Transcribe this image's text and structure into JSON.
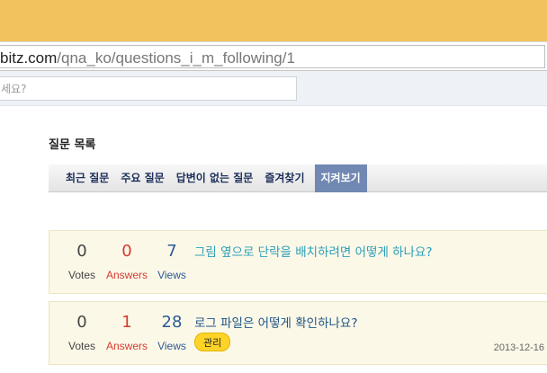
{
  "browser": {
    "url_host": "bitz.com",
    "url_path": "/qna_ko/questions_i_m_following/1"
  },
  "search": {
    "placeholder": "세요?"
  },
  "page": {
    "title": "질문 목록"
  },
  "tabs": [
    {
      "label": "최근 질문"
    },
    {
      "label": "주요 질문"
    },
    {
      "label": "답변이 없는 질문"
    },
    {
      "label": "즐겨찾기"
    },
    {
      "label": "지켜보기",
      "active": true
    }
  ],
  "questions": [
    {
      "votes": "0",
      "votes_label": "Votes",
      "answers": "0",
      "answers_label": "Answers",
      "views": "7",
      "views_label": "Views",
      "title": "그림 옆으로 단락을 배치하려면 어떻게 하나요?"
    },
    {
      "votes": "0",
      "votes_label": "Votes",
      "answers": "1",
      "answers_label": "Answers",
      "views": "28",
      "views_label": "Views",
      "title": "로그 파일은 어떻게 확인하나요?",
      "tag": "관리",
      "date": "2013-12-16"
    }
  ],
  "colors": {
    "titlebar": "#f0c35d",
    "active_tab": "#7088b2",
    "answers": "#d63a2f",
    "views": "#2a5a95",
    "tag": "#ffd428"
  }
}
